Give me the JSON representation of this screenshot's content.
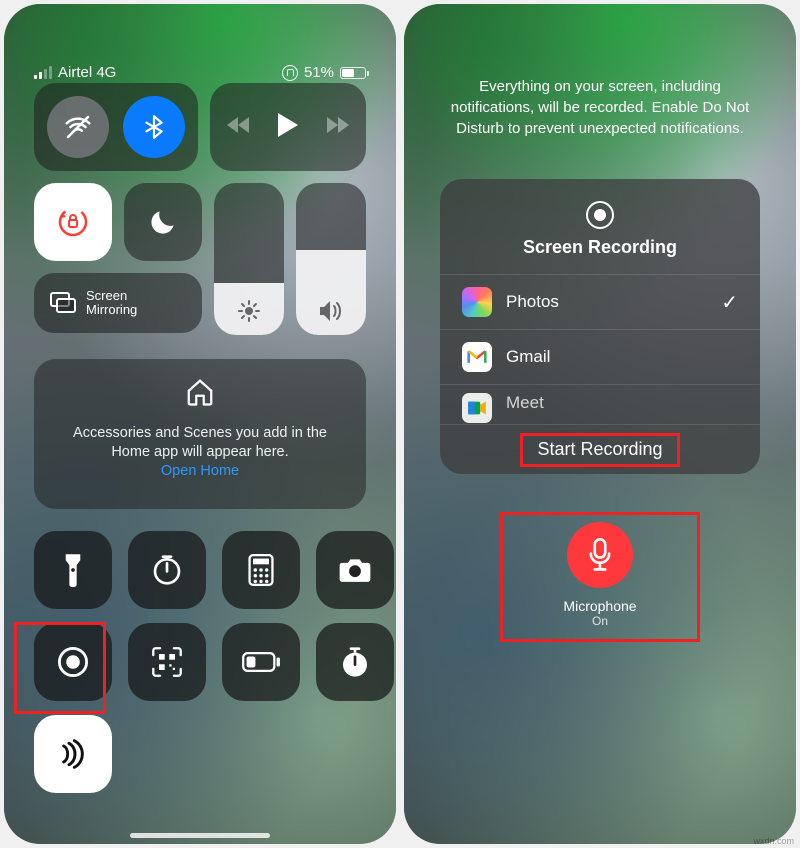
{
  "left": {
    "status": {
      "carrier": "Airtel 4G",
      "battery_pct": "51%"
    },
    "screen_mirror_label": "Screen\nMirroring",
    "home_card": {
      "text": "Accessories and Scenes you add in the Home app will appear here.",
      "link": "Open Home"
    }
  },
  "right": {
    "info": "Everything on your screen, including notifications, will be recorded. Enable Do Not Disturb to prevent unexpected notifications.",
    "sheet": {
      "title": "Screen Recording",
      "apps": [
        {
          "name": "Photos",
          "selected": true
        },
        {
          "name": "Gmail",
          "selected": false
        },
        {
          "name": "Meet",
          "selected": false
        }
      ],
      "start_label": "Start Recording"
    },
    "mic": {
      "label": "Microphone",
      "state": "On"
    }
  }
}
